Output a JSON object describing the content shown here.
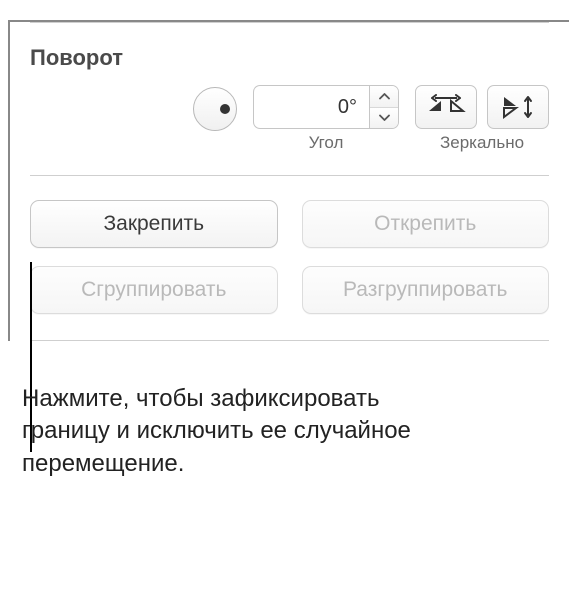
{
  "rotation": {
    "title": "Поворот",
    "angle_value": "0°",
    "angle_label": "Угол",
    "mirror_label": "Зеркально"
  },
  "buttons": {
    "lock": "Закрепить",
    "unlock": "Открепить",
    "group": "Сгруппировать",
    "ungroup": "Разгруппировать"
  },
  "callout": {
    "text": "Нажмите, чтобы зафиксировать границу и исключить ее случайное перемещение."
  }
}
